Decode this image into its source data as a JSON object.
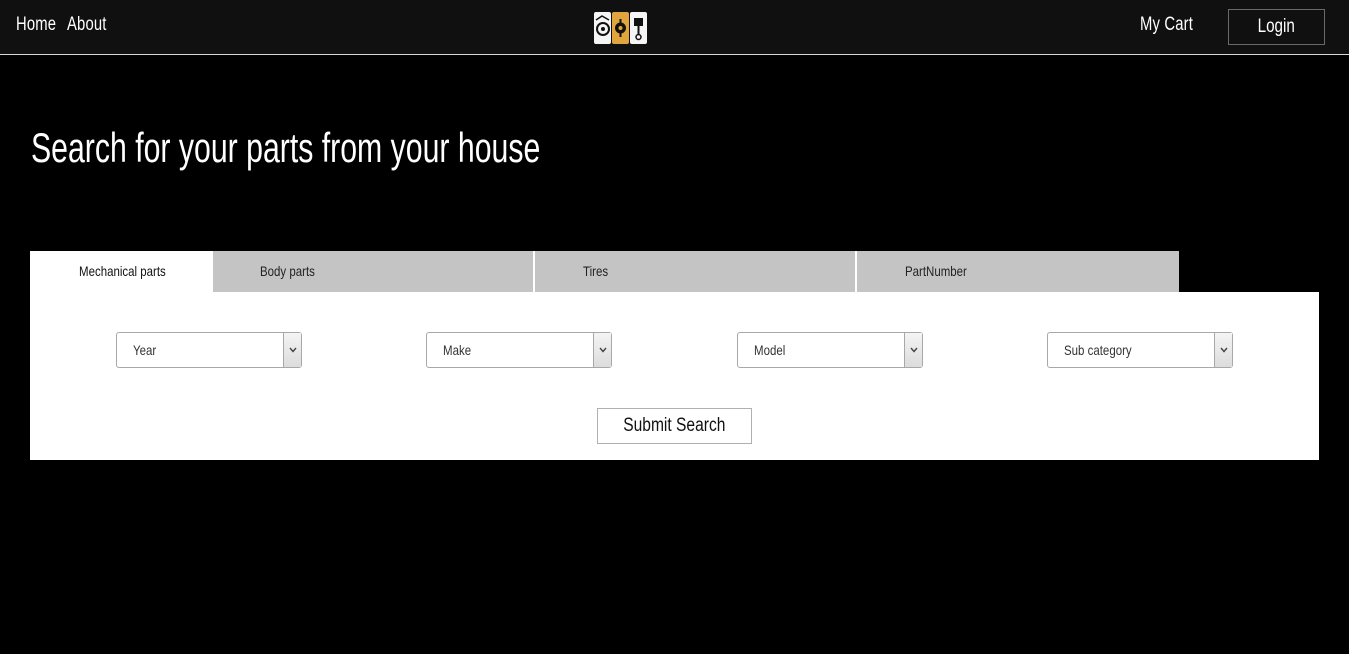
{
  "nav": {
    "home": "Home",
    "about": "About",
    "cart": "My Cart",
    "login": "Login"
  },
  "brand": {
    "colors": {
      "navbar_bg": "#101010",
      "accent": "#e0a53c",
      "tab_inactive": "#c4c4c4"
    }
  },
  "hero": {
    "title": "Search for your parts from your house"
  },
  "tabs": [
    {
      "label": "Mechanical parts",
      "active": true
    },
    {
      "label": "Body parts",
      "active": false
    },
    {
      "label": "Tires",
      "active": false
    },
    {
      "label": "PartNumber",
      "active": false
    }
  ],
  "filters": {
    "year": "Year",
    "make": "Make",
    "model": "Model",
    "subcategory": "Sub category"
  },
  "submit_label": "Submit Search"
}
